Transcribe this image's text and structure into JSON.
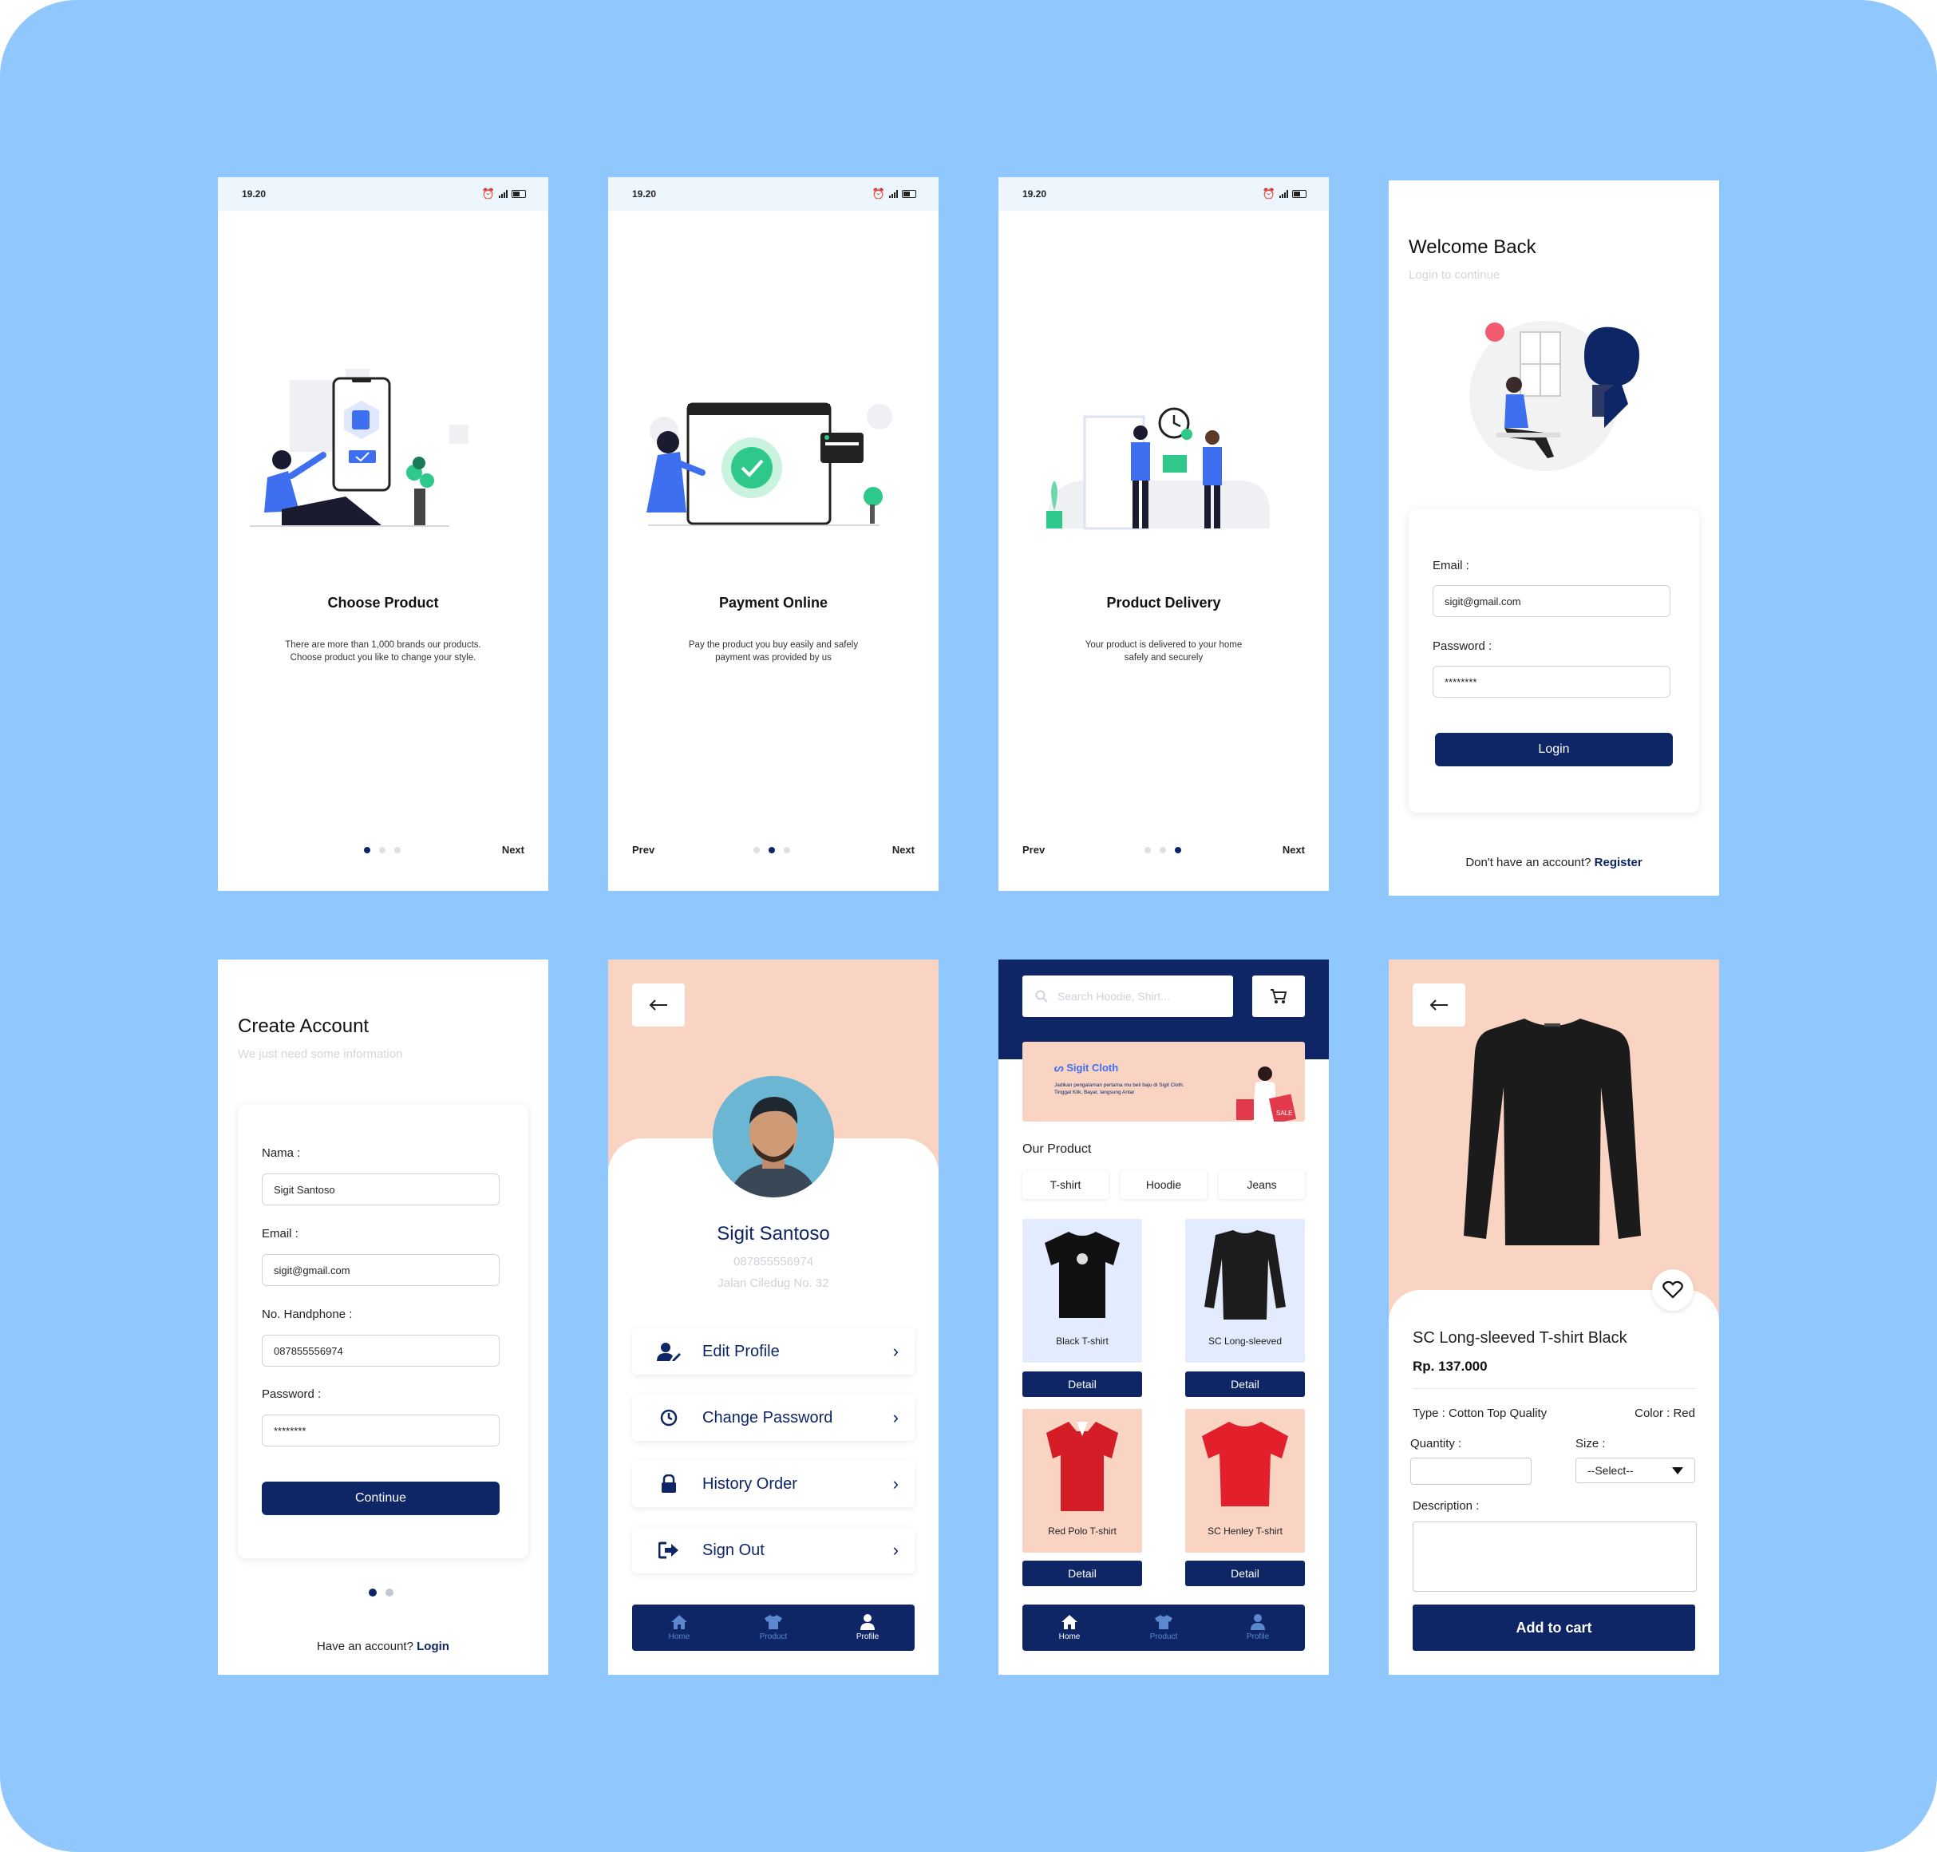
{
  "status": {
    "time": "19.20"
  },
  "onboarding": [
    {
      "title": "Choose Product",
      "desc1": "There are more than 1,000 brands our products.",
      "desc2": "Choose product you like to change your style.",
      "prev": "",
      "next": "Next"
    },
    {
      "title": "Payment Online",
      "desc1": "Pay the product you buy easily and safely",
      "desc2": "payment was provided by us",
      "prev": "Prev",
      "next": "Next"
    },
    {
      "title": "Product Delivery",
      "desc1": "Your product is delivered to your home",
      "desc2": "safely and securely",
      "prev": "Prev",
      "next": "Next"
    }
  ],
  "login": {
    "title": "Welcome Back",
    "subtitle": "Login to continue",
    "email_label": "Email :",
    "email_value": "sigit@gmail.com",
    "password_label": "Password :",
    "password_value": "********",
    "button": "Login",
    "footer_text": "Don't have an account?",
    "footer_link": "Register"
  },
  "register": {
    "title": "Create Account",
    "subtitle": "We just need some information",
    "name_label": "Nama :",
    "name_value": "Sigit Santoso",
    "email_label": "Email :",
    "email_value": "sigit@gmail.com",
    "phone_label": "No. Handphone :",
    "phone_value": "087855556974",
    "password_label": "Password :",
    "password_value": "********",
    "button": "Continue",
    "footer_text": "Have an account?",
    "footer_link": "Login"
  },
  "profile": {
    "name": "Sigit Santoso",
    "phone": "087855556974",
    "address": "Jalan Ciledug No. 32",
    "menu": [
      {
        "label": "Edit Profile",
        "icon": "user-edit-icon"
      },
      {
        "label": "Change Password",
        "icon": "history-icon"
      },
      {
        "label": "History Order",
        "icon": "lock-icon"
      },
      {
        "label": "Sign Out",
        "icon": "sign-out-icon"
      }
    ]
  },
  "nav": {
    "home": "Home",
    "product": "Product",
    "profile": "Profile"
  },
  "shop": {
    "search_placeholder": "Search Hoodie, Shirt...",
    "banner_brand": "Sigit Cloth",
    "banner_line1": "Jadikan pengalaman pertama mu beli baju di Sigit Cloth.",
    "banner_line2": "Tinggal Klik, Bayar, langsung Antar",
    "banner_sale": "SALE",
    "section_title": "Our Product",
    "tabs": [
      "T-shirt",
      "Hoodie",
      "Jeans"
    ],
    "products": [
      {
        "name": "Black T-shirt",
        "bg": "#e3ecfe"
      },
      {
        "name": "SC Long-sleeved",
        "bg": "#e3ecfe"
      },
      {
        "name": "Red Polo T-shirt",
        "bg": "#f9d4c2"
      },
      {
        "name": "SC Henley T-shirt",
        "bg": "#f9d4c2"
      }
    ],
    "detail_label": "Detail"
  },
  "detail": {
    "name": "SC Long-sleeved T-shirt Black",
    "price": "Rp. 137.000",
    "type": "Type : Cotton Top Quality",
    "color": "Color : Red",
    "quantity_label": "Quantity :",
    "size_label": "Size :",
    "size_value": "--Select--",
    "description_label": "Description :",
    "button": "Add to cart"
  },
  "colors": {
    "background": "#90c8fd",
    "navy": "#0e2566",
    "peach": "#f9d4c2",
    "accent_blue": "#3d6ff0",
    "accent_green": "#2ec98a"
  }
}
